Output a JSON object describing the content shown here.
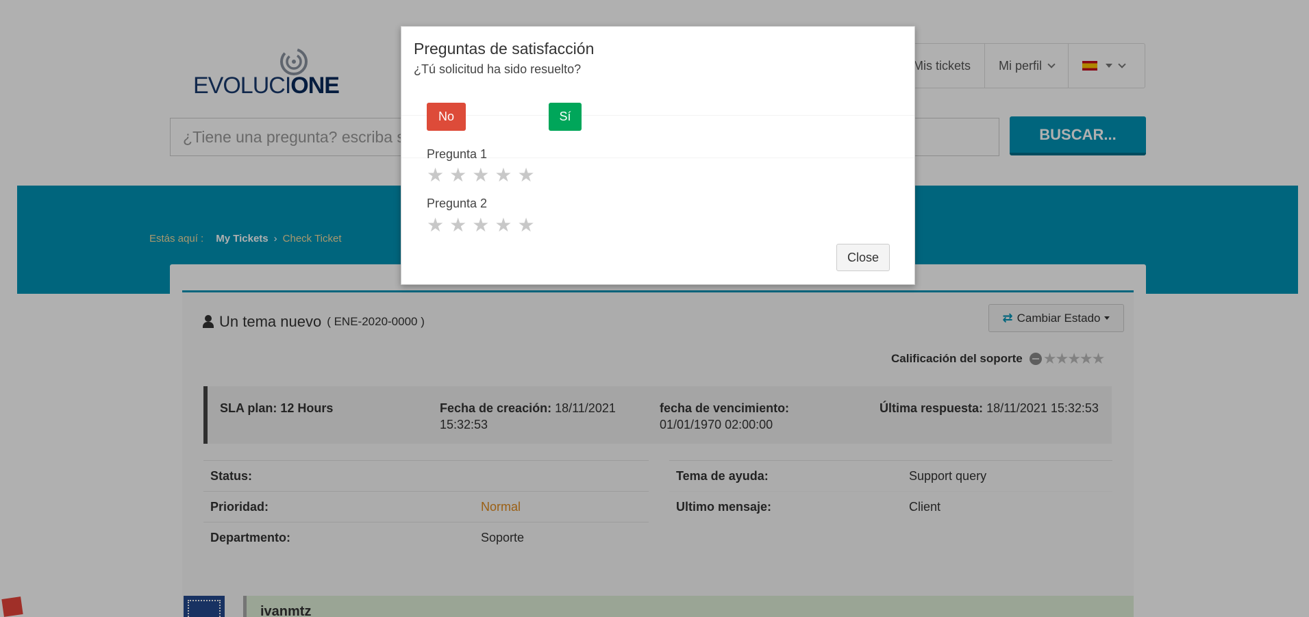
{
  "header": {
    "brand_prefix": "EVOLUCI",
    "brand_suffix": "ONE",
    "nav": [
      {
        "label": "Mis tickets"
      },
      {
        "label": "Mi perfil"
      }
    ],
    "language_icon": "spain-flag-icon",
    "search_placeholder": "¿Tiene una pregunta? escriba su búsqueda aquí...",
    "search_button": "BUSCAR..."
  },
  "breadcrumb": {
    "prefix": "Estás aquí :",
    "items": [
      "My Tickets",
      "Check Ticket"
    ],
    "separator": "›"
  },
  "ticket": {
    "title": "Un tema nuevo",
    "number": "( ENE-2020-0000 )",
    "state_button": "Cambiar Estado",
    "rating_label": "Calificación del soporte",
    "rating_stars": "★★★★★",
    "sla": [
      {
        "key": "SLA plan:",
        "value": "12 Hours"
      },
      {
        "key": "Fecha de creación:",
        "value": "18/11/2021 15:32:53"
      },
      {
        "key": "fecha de vencimiento:",
        "value": "01/01/1970 02:00:00"
      },
      {
        "key": "Última respuesta:",
        "value": "18/11/2021 15:32:53"
      }
    ],
    "details_left": [
      {
        "key": "Status:",
        "value": ""
      },
      {
        "key": "Prioridad:",
        "value": "Normal"
      },
      {
        "key": "Departmento:",
        "value": "Soporte"
      }
    ],
    "details_right": [
      {
        "key": "Tema de ayuda:",
        "value": "Support query"
      },
      {
        "key": "Ultimo mensaje:",
        "value": "Client"
      }
    ],
    "post_author": "ivanmtz"
  },
  "colors": {
    "accent": "#0093b5",
    "danger": "#dd4b39",
    "success": "#00a65a",
    "priority_normal": "#e08a1e"
  },
  "modal": {
    "title": "Preguntas de satisfacción",
    "subtitle": "¿Tú solicitud ha sido resuelto?",
    "no_label": "No",
    "yes_label": "Sí",
    "questions": [
      {
        "label": "Pregunta 1",
        "rating": 0,
        "max": 5
      },
      {
        "label": "Pregunta 2",
        "rating": 0,
        "max": 5
      }
    ],
    "close_label": "Close"
  }
}
